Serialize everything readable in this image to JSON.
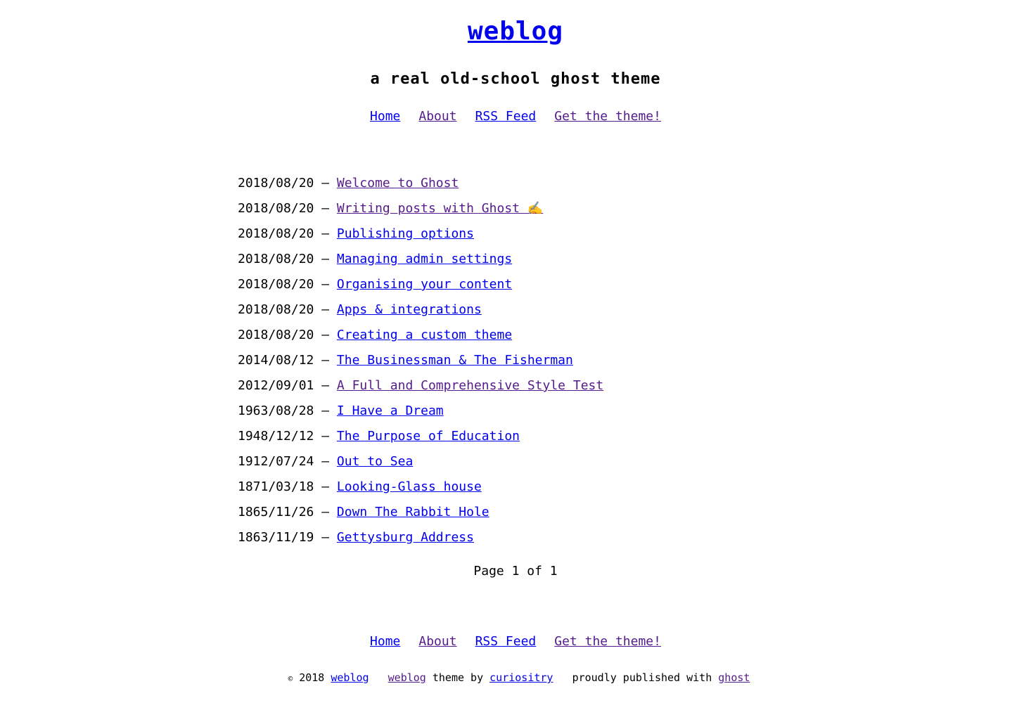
{
  "site": {
    "title": "weblog",
    "description": "a real old-school ghost theme"
  },
  "nav": {
    "home": "Home",
    "about": "About",
    "rss": "RSS Feed",
    "theme": "Get the theme!"
  },
  "posts": [
    {
      "date": "2018/08/20",
      "title": "Welcome to Ghost"
    },
    {
      "date": "2018/08/20",
      "title": "Writing posts with Ghost ✍️"
    },
    {
      "date": "2018/08/20",
      "title": "Publishing options"
    },
    {
      "date": "2018/08/20",
      "title": "Managing admin settings"
    },
    {
      "date": "2018/08/20",
      "title": "Organising your content"
    },
    {
      "date": "2018/08/20",
      "title": "Apps & integrations"
    },
    {
      "date": "2018/08/20",
      "title": "Creating a custom theme"
    },
    {
      "date": "2014/08/12",
      "title": "The Businessman & The Fisherman"
    },
    {
      "date": "2012/09/01",
      "title": "A Full and Comprehensive Style Test"
    },
    {
      "date": "1963/08/28",
      "title": "I Have a Dream"
    },
    {
      "date": "1948/12/12",
      "title": "The Purpose of Education"
    },
    {
      "date": "1912/07/24",
      "title": "Out to Sea"
    },
    {
      "date": "1871/03/18",
      "title": "Looking-Glass house"
    },
    {
      "date": "1865/11/26",
      "title": "Down The Rabbit Hole"
    },
    {
      "date": "1863/11/19",
      "title": "Gettysburg Address"
    }
  ],
  "separator": "—",
  "pagination": {
    "text": "Page 1 of 1"
  },
  "footer": {
    "copyright_symbol": "©",
    "year": "2018",
    "site_link": "weblog",
    "theme_link": "weblog",
    "theme_by": "theme by",
    "author_link": "curiositry",
    "published_with": "proudly published with",
    "ghost_link": "ghost"
  },
  "colors": {
    "link": "#0000ee",
    "visited_link": "#551a8b",
    "text": "#000000",
    "background": "#ffffff"
  }
}
